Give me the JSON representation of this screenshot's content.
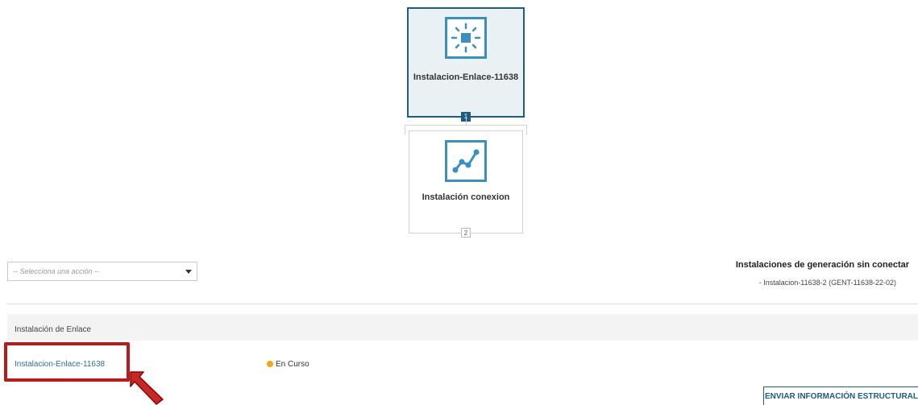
{
  "diagram": {
    "main_node": {
      "label": "Instalacion-Enlace-11638",
      "number": "1",
      "icon": "sun-square-icon"
    },
    "child_node": {
      "label": "Instalación conexion",
      "number": "2",
      "icon": "line-chart-icon"
    }
  },
  "action_select": {
    "placeholder": "-- Selecciona una acción --"
  },
  "unconnected": {
    "title": "Instalaciones de generación sin conectar",
    "items": [
      "- Instalacion-11638-2 (GENT-11638-22-02)"
    ]
  },
  "section": {
    "title": "Instalación de Enlace",
    "row": {
      "link": "Instalacion-Enlace-11638",
      "status": "En Curso",
      "status_color": "#f3a712"
    }
  },
  "buttons": {
    "send": "ENVIAR INFORMACIÓN ESTRUCTURAL"
  },
  "colors": {
    "primary": "#1d5d82",
    "accent_icon": "#3a8fbf",
    "highlight": "#b71c1c"
  }
}
